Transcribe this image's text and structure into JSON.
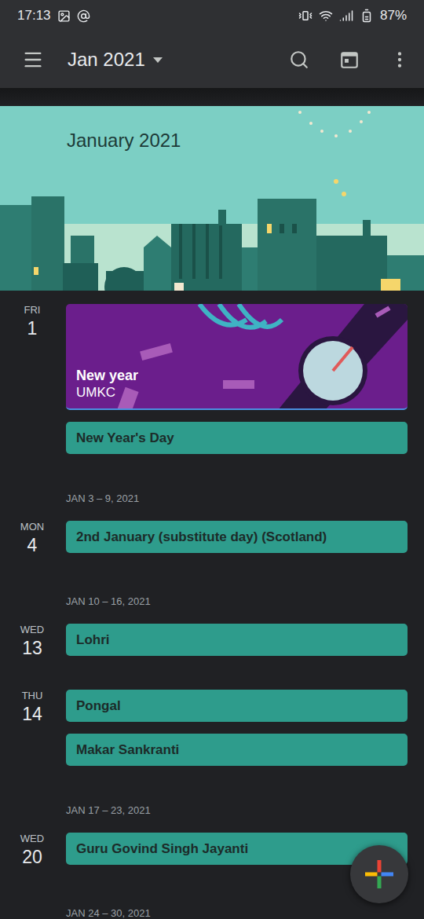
{
  "status_bar": {
    "time": "17:13",
    "battery": "87%"
  },
  "app_bar": {
    "title": "Jan 2021"
  },
  "banner": {
    "title": "January 2021"
  },
  "agenda": [
    {
      "kind": "day",
      "weekday": "FRI",
      "date": "1",
      "events": [
        {
          "kind": "image",
          "title": "New year",
          "subtitle": "UMKC",
          "color": "#6b1e8c"
        },
        {
          "kind": "plain",
          "title": "New Year's Day",
          "color": "#2e9c8c"
        }
      ]
    },
    {
      "kind": "week",
      "label": "JAN 3 – 9, 2021"
    },
    {
      "kind": "day",
      "weekday": "MON",
      "date": "4",
      "events": [
        {
          "kind": "plain",
          "title": "2nd January (substitute day) (Scotland)",
          "color": "#2e9c8c"
        }
      ]
    },
    {
      "kind": "week",
      "label": "JAN 10 – 16, 2021"
    },
    {
      "kind": "day",
      "weekday": "WED",
      "date": "13",
      "events": [
        {
          "kind": "plain",
          "title": "Lohri",
          "color": "#2e9c8c"
        }
      ]
    },
    {
      "kind": "day",
      "weekday": "THU",
      "date": "14",
      "events": [
        {
          "kind": "plain",
          "title": "Pongal",
          "color": "#2e9c8c"
        },
        {
          "kind": "plain",
          "title": "Makar Sankranti",
          "color": "#2e9c8c"
        }
      ]
    },
    {
      "kind": "week",
      "label": "JAN 17 – 23, 2021"
    },
    {
      "kind": "day",
      "weekday": "WED",
      "date": "20",
      "events": [
        {
          "kind": "plain",
          "title": "Guru Govind Singh Jayanti",
          "color": "#2e9c8c"
        }
      ]
    },
    {
      "kind": "week",
      "label": "JAN 24 – 30, 2021"
    }
  ]
}
